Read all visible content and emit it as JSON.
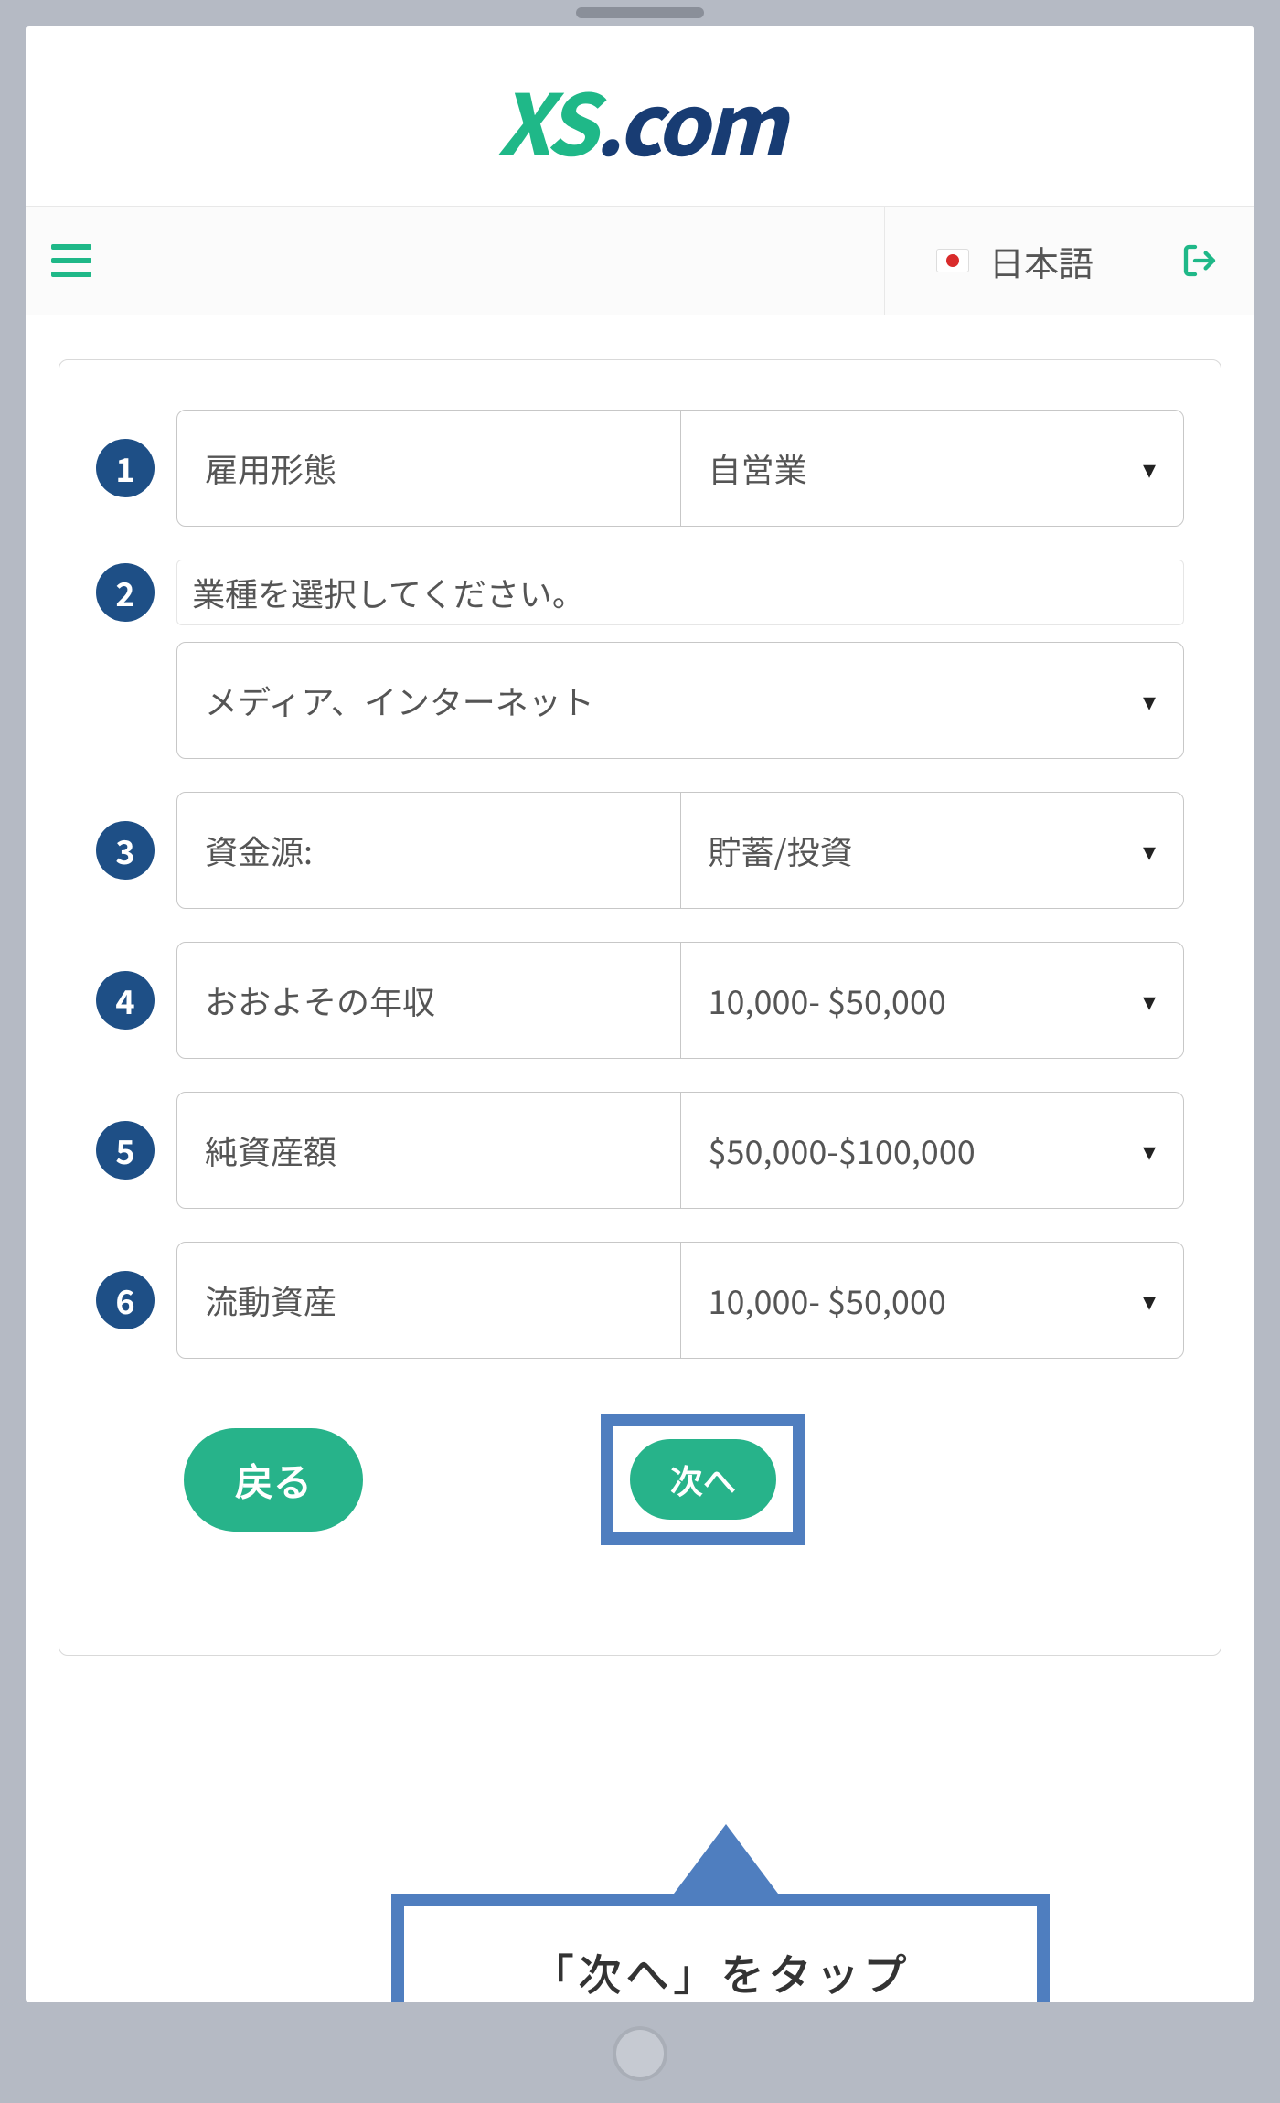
{
  "logo": {
    "part1": "XS",
    "part2": ".com"
  },
  "topbar": {
    "language_label": "日本語"
  },
  "form": {
    "rows": [
      {
        "num": "1",
        "label": "雇用形態",
        "value": "自営業"
      },
      {
        "num": "2",
        "label": "業種を選択してください。",
        "value": "メディア、インターネット",
        "fullwidth": true
      },
      {
        "num": "3",
        "label": "資金源:",
        "value": "貯蓄/投資"
      },
      {
        "num": "4",
        "label": "おおよその年収",
        "value": "10,000- $50,000"
      },
      {
        "num": "5",
        "label": "純資産額",
        "value": "$50,000-$100,000"
      },
      {
        "num": "6",
        "label": "流動資産",
        "value": "10,000- $50,000"
      }
    ],
    "back_label": "戻る",
    "next_label": "次へ"
  },
  "callout": {
    "text": "「次へ」をタップ"
  }
}
